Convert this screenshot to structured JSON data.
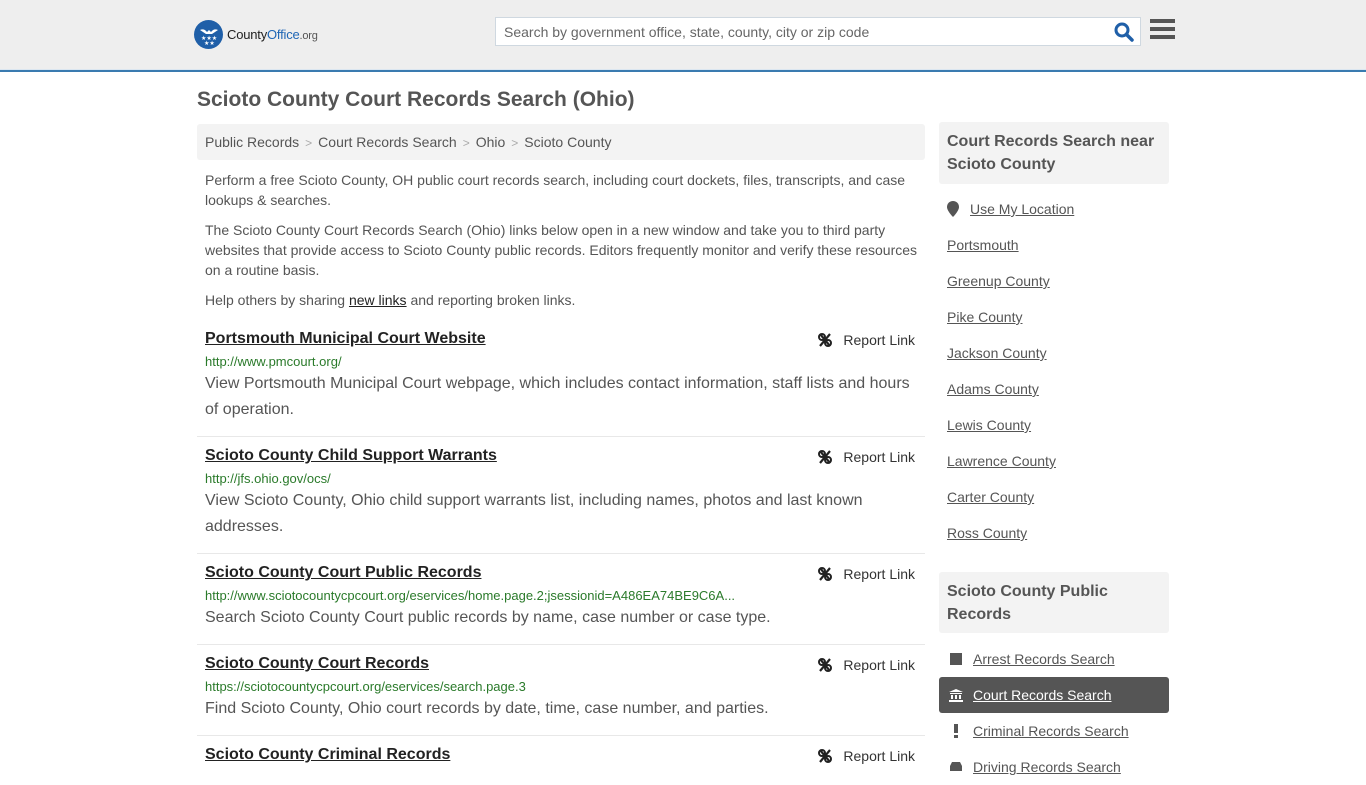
{
  "header": {
    "logo": {
      "county": "County",
      "office": "Office",
      "org": ".org"
    },
    "search": {
      "placeholder": "Search by government office, state, county, city or zip code",
      "value": ""
    },
    "icons": {
      "search": "search-icon",
      "menu": "hamburger-menu-icon"
    }
  },
  "page": {
    "title": "Scioto County Court Records Search (Ohio)",
    "breadcrumb": [
      "Public Records",
      "Court Records Search",
      "Ohio",
      "Scioto County"
    ],
    "intro": {
      "p1": "Perform a free Scioto County, OH public court records search, including court dockets, files, transcripts, and case lookups & searches.",
      "p2": "The Scioto County Court Records Search (Ohio) links below open in a new window and take you to third party websites that provide access to Scioto County public records. Editors frequently monitor and verify these resources on a routine basis.",
      "p3_before": "Help others by sharing ",
      "p3_link": "new links",
      "p3_after": " and reporting broken links."
    }
  },
  "results": [
    {
      "title": "Portsmouth Municipal Court Website",
      "url": "http://www.pmcourt.org/",
      "desc": "View Portsmouth Municipal Court webpage, which includes contact information, staff lists and hours of operation.",
      "report": "Report Link"
    },
    {
      "title": "Scioto County Child Support Warrants",
      "url": "http://jfs.ohio.gov/ocs/",
      "desc": "View Scioto County, Ohio child support warrants list, including names, photos and last known addresses.",
      "report": "Report Link"
    },
    {
      "title": "Scioto County Court Public Records",
      "url": "http://www.sciotocountycpcourt.org/eservices/home.page.2;jsessionid=A486EA74BE9C6A...",
      "desc": "Search Scioto County Court public records by name, case number or case type.",
      "report": "Report Link"
    },
    {
      "title": "Scioto County Court Records",
      "url": "https://sciotocountycpcourt.org/eservices/search.page.3",
      "desc": "Find Scioto County, Ohio court records by date, time, case number, and parties.",
      "report": "Report Link"
    },
    {
      "title": "Scioto County Criminal Records",
      "url": "",
      "desc": "",
      "report": "Report Link"
    }
  ],
  "sidebar": {
    "nearby_title": "Court Records Search near Scioto County",
    "use_location": "Use My Location",
    "nearby": [
      "Portsmouth",
      "Greenup County",
      "Pike County",
      "Jackson County",
      "Adams County",
      "Lewis County",
      "Lawrence County",
      "Carter County",
      "Ross County"
    ],
    "public_records_title": "Scioto County Public Records",
    "public_records": [
      {
        "label": "Arrest Records Search",
        "icon": "square-icon",
        "active": false
      },
      {
        "label": "Court Records Search",
        "icon": "courthouse-icon",
        "active": true
      },
      {
        "label": "Criminal Records Search",
        "icon": "exclamation-icon",
        "active": false
      },
      {
        "label": "Driving Records Search",
        "icon": "car-icon",
        "active": false
      }
    ]
  },
  "colors": {
    "accent": "#3a7bb0",
    "brand_blue": "#1f5fa8",
    "url_green": "#2a7a2a",
    "active_bg": "#555555"
  }
}
